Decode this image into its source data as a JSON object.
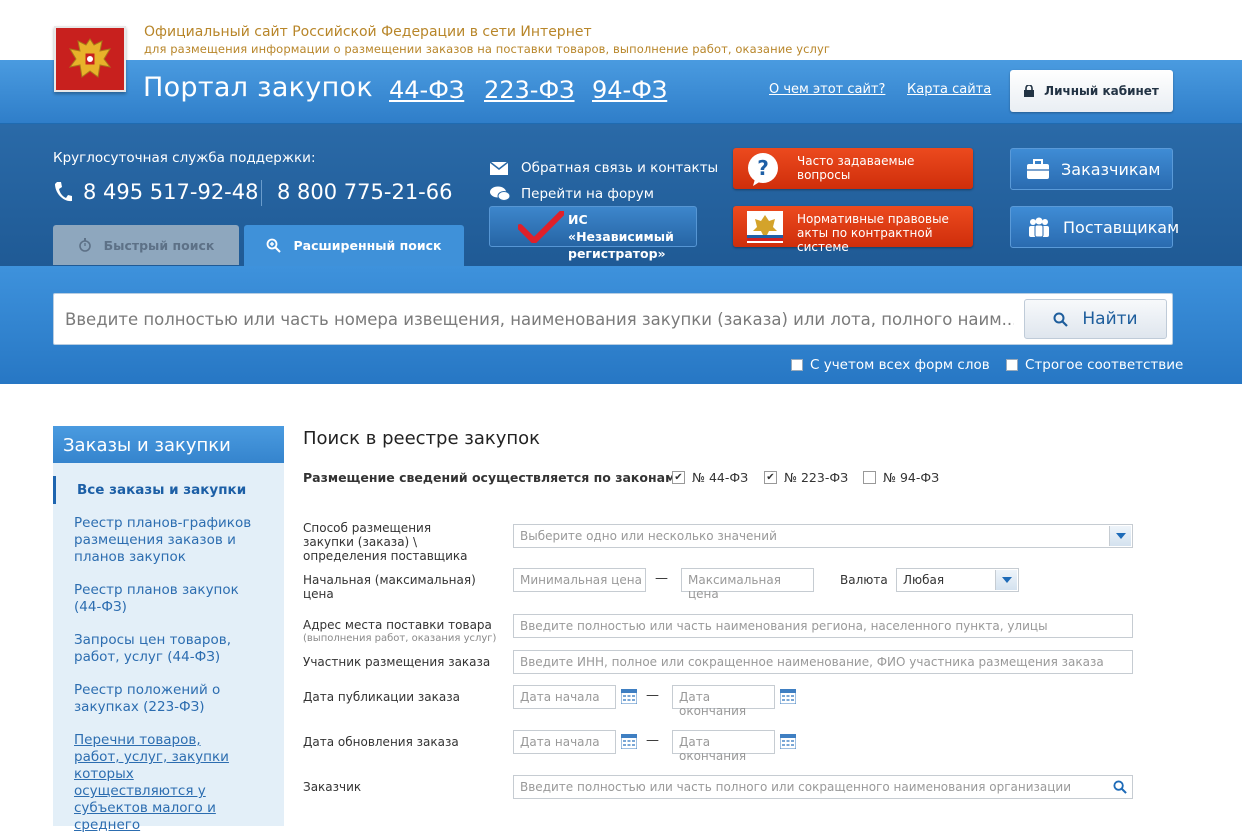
{
  "header": {
    "site_title": "Официальный сайт Российской Федерации в сети Интернет",
    "site_subtitle": "для размещения информации о размещении заказов на поставки товаров, выполнение работ, оказание услуг",
    "portal_name": "Портал закупок",
    "law_links": [
      "44-ФЗ",
      "223-ФЗ",
      "94-ФЗ"
    ],
    "about_link": "О чем этот сайт?",
    "sitemap_link": "Карта сайта",
    "cabinet_button": "Личный кабинет"
  },
  "support": {
    "label": "Круглосуточная служба поддержки:",
    "phone1": "8 495 517-92-48",
    "phone2": "8 800 775-21-66"
  },
  "tabs": {
    "fast": "Быстрый поиск",
    "extended": "Расширенный поиск"
  },
  "links": {
    "feedback": "Обратная связь и контакты",
    "forum": "Перейти на форум",
    "registrar": "ИС «Независимый регистратор»",
    "faq": "Часто задаваемые вопросы",
    "normative": "Нормативные правовые акты по контрактной системе",
    "customers": "Заказчикам",
    "suppliers": "Поставщикам"
  },
  "search": {
    "placeholder": "Введите полностью или часть номера извещения, наименования закупки (заказа) или лота, полного наим...",
    "button": "Найти",
    "option_all_forms": "С учетом всех форм слов",
    "option_strict": "Строгое соответствие"
  },
  "sidebar": {
    "title": "Заказы и закупки",
    "active": "Все заказы и закупки",
    "items": [
      "Реестр планов-графиков размещения заказов и планов закупок",
      "Реестр планов закупок (44-ФЗ)",
      "Запросы цен товаров, работ, услуг (44-ФЗ)",
      "Реестр положений о закупках (223-ФЗ)",
      "Перечни товаров, работ, услуг, закупки которых осуществляются у субъектов малого и среднего"
    ]
  },
  "form": {
    "title": "Поиск в реестре закупок",
    "laws_label": "Размещение сведений осуществляется по законам",
    "law_checkboxes": [
      {
        "label": "№ 44-ФЗ",
        "checked": true
      },
      {
        "label": "№ 223-ФЗ",
        "checked": true
      },
      {
        "label": "№ 94-ФЗ",
        "checked": false
      }
    ],
    "method_label": "Способ размещения закупки (заказа) \\ определения поставщика",
    "method_placeholder": "Выберите одно или несколько значений",
    "price_label": "Начальная (максимальная) цена",
    "price_min": "Минимальная цена",
    "price_max": "Максимальная цена",
    "currency_label": "Валюта",
    "currency_value": "Любая",
    "address_label": "Адрес места поставки товара",
    "address_sublabel": "(выполнения работ, оказания услуг)",
    "address_placeholder": "Введите полностью или часть наименования региона, населенного пункта, улицы",
    "participant_label": "Участник размещения заказа",
    "participant_placeholder": "Введите ИНН, полное или сокращенное наименование, ФИО участника размещения заказа",
    "pub_date_label": "Дата публикации заказа",
    "upd_date_label": "Дата обновления заказа",
    "date_start": "Дата начала",
    "date_end": "Дата окончания",
    "customer_label": "Заказчик",
    "customer_placeholder": "Введите полностью или часть полного или сокращенного наименования организации"
  }
}
